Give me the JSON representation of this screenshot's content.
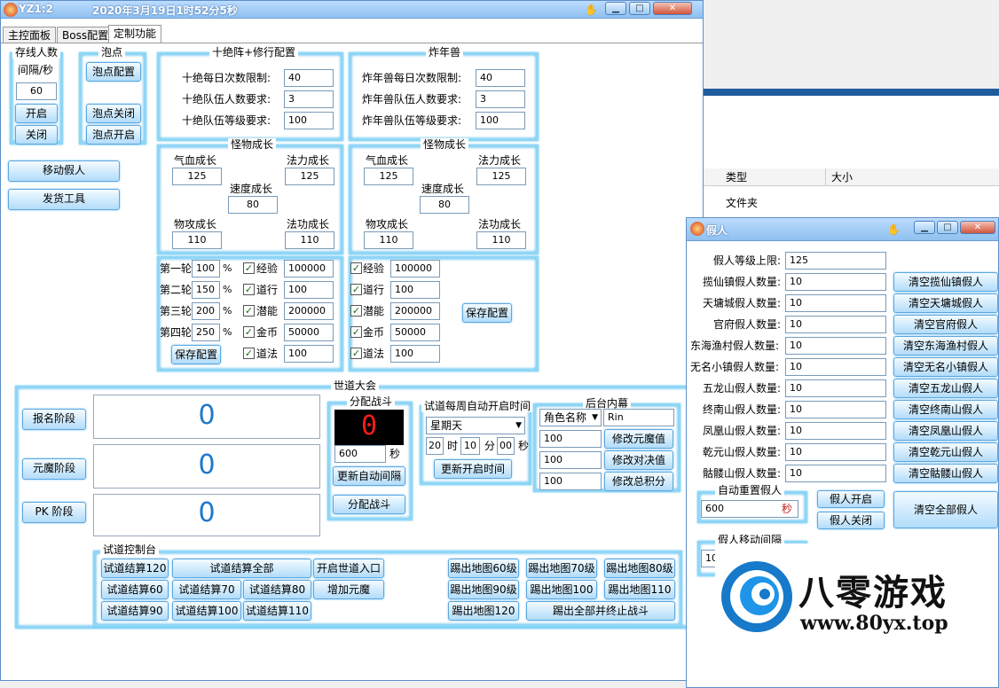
{
  "main_window": {
    "title": "YZ1:2",
    "datetime": "2020年3月19日1时52分5秒",
    "tabs": [
      "主控面板",
      "Boss配置",
      "定制功能"
    ]
  },
  "online": {
    "title": "存线人数",
    "interval_label": "间隔/秒",
    "interval_value": "60",
    "open_label": "开启",
    "close_label": "关闭"
  },
  "bubble": {
    "title": "泡点",
    "config_label": "泡点配置",
    "off_label": "泡点关闭",
    "on_label": "泡点开启"
  },
  "side_buttons": {
    "move_fake": "移动假人",
    "ship_tool": "发货工具"
  },
  "shijue": {
    "title": "十绝阵+修行配置",
    "rows": [
      {
        "label": "十绝每日次数限制:",
        "value": "40"
      },
      {
        "label": "十绝队伍人数要求:",
        "value": "3"
      },
      {
        "label": "十绝队伍等级要求:",
        "value": "100"
      }
    ]
  },
  "beast": {
    "title": "炸年兽",
    "rows": [
      {
        "label": "炸年兽每日次数限制:",
        "value": "40"
      },
      {
        "label": "炸年兽队伍人数要求:",
        "value": "3"
      },
      {
        "label": "炸年兽队伍等级要求:",
        "value": "100"
      }
    ]
  },
  "growth_left": {
    "title": "怪物成长",
    "hp_label": "气血成长",
    "hp": "125",
    "mp_label": "法力成长",
    "mp": "125",
    "spd_label": "速度成长",
    "spd": "80",
    "atk_label": "物攻成长",
    "atk": "110",
    "matk_label": "法功成长",
    "matk": "110"
  },
  "growth_right": {
    "title": "怪物成长",
    "hp_label": "气血成长",
    "hp": "125",
    "mp_label": "法力成长",
    "mp": "125",
    "spd_label": "速度成长",
    "spd": "80",
    "atk_label": "物攻成长",
    "atk": "110",
    "matk_label": "法功成长",
    "matk": "110"
  },
  "rounds_left": {
    "pct_unit": "%",
    "rounds": [
      {
        "label": "第一轮",
        "pct": "100",
        "item": "经验",
        "value": "100000"
      },
      {
        "label": "第二轮",
        "pct": "150",
        "item": "道行",
        "value": "100"
      },
      {
        "label": "第三轮",
        "pct": "200",
        "item": "潜能",
        "value": "200000"
      },
      {
        "label": "第四轮",
        "pct": "250",
        "item": "金币",
        "value": "50000"
      }
    ],
    "extra_item": "道法",
    "extra_value": "100",
    "save_label": "保存配置"
  },
  "rounds_right": {
    "items": [
      {
        "item": "经验",
        "value": "100000"
      },
      {
        "item": "道行",
        "value": "100"
      },
      {
        "item": "潜能",
        "value": "200000"
      },
      {
        "item": "金币",
        "value": "50000"
      },
      {
        "item": "道法",
        "value": "100"
      }
    ],
    "save_label": "保存配置"
  },
  "tournament": {
    "title": "世道大会",
    "stages": [
      {
        "label": "报名阶段",
        "count": "0"
      },
      {
        "label": "元魔阶段",
        "count": "0"
      },
      {
        "label": "PK 阶段",
        "count": "0"
      }
    ],
    "match": {
      "title": "分配战斗",
      "counter": "0",
      "interval": "600",
      "unit": "秒",
      "update_label": "更新自动间隔",
      "assign_label": "分配战斗"
    },
    "weekly": {
      "title": "试道每周自动开启时间",
      "day": "星期天",
      "hour": "20",
      "hour_unit": "时",
      "minute": "10",
      "minute_unit": "分",
      "second": "00",
      "second_unit": "秒",
      "update_label": "更新开启时间"
    },
    "backend": {
      "title": "后台内幕",
      "role_select": "角色名称",
      "role_value": "Rin",
      "rows": [
        {
          "value": "100",
          "action": "修改元魔值"
        },
        {
          "value": "100",
          "action": "修改对决值"
        },
        {
          "value": "100",
          "action": "修改总积分"
        }
      ]
    },
    "console": {
      "title": "试道控制台",
      "row1": [
        "试道结算120",
        "试道结算全部",
        "开启世道入口"
      ],
      "row2": [
        "试道结算60",
        "试道结算70",
        "试道结算80",
        "增加元魔"
      ],
      "row3": [
        "试道结算90",
        "试道结算100",
        "试道结算110"
      ],
      "kick1": [
        "踢出地图60级",
        "踢出地图70级",
        "踢出地图80级"
      ],
      "kick2": [
        "踢出地图90级",
        "踢出地图100",
        "踢出地图110"
      ],
      "kick3": [
        "踢出地图120",
        "踢出全部并终止战斗"
      ]
    }
  },
  "explorer": {
    "col_type": "类型",
    "col_size": "大小",
    "row_type": "文件夹"
  },
  "fake_window": {
    "title": "假人",
    "level_label": "假人等级上限:",
    "level_value": "125",
    "rows": [
      {
        "label": "揽仙镇假人数量:",
        "value": "10",
        "action": "清空揽仙镇假人"
      },
      {
        "label": "天墉城假人数量:",
        "value": "10",
        "action": "清空天墉城假人"
      },
      {
        "label": "官府假人数量:",
        "value": "10",
        "action": "清空官府假人"
      },
      {
        "label": "东海渔村假人数量:",
        "value": "10",
        "action": "清空东海渔村假人"
      },
      {
        "label": "无名小镇假人数量:",
        "value": "10",
        "action": "清空无名小镇假人"
      },
      {
        "label": "五龙山假人数量:",
        "value": "10",
        "action": "清空五龙山假人"
      },
      {
        "label": "终南山假人数量:",
        "value": "10",
        "action": "清空终南山假人"
      },
      {
        "label": "凤凰山假人数量:",
        "value": "10",
        "action": "清空凤凰山假人"
      },
      {
        "label": "乾元山假人数量:",
        "value": "10",
        "action": "清空乾元山假人"
      },
      {
        "label": "骷髅山假人数量:",
        "value": "10",
        "action": "清空骷髅山假人"
      }
    ],
    "resend_title": "自动重置假人",
    "resend_value": "600",
    "resend_unit": "秒",
    "fake_on": "假人开启",
    "fake_off": "假人关闭",
    "clear_all": "清空全部假人",
    "move_title": "假人移动间隔",
    "move_value": "10"
  },
  "watermark": {
    "brand": "八零游戏",
    "url": "www.80yx.top"
  }
}
